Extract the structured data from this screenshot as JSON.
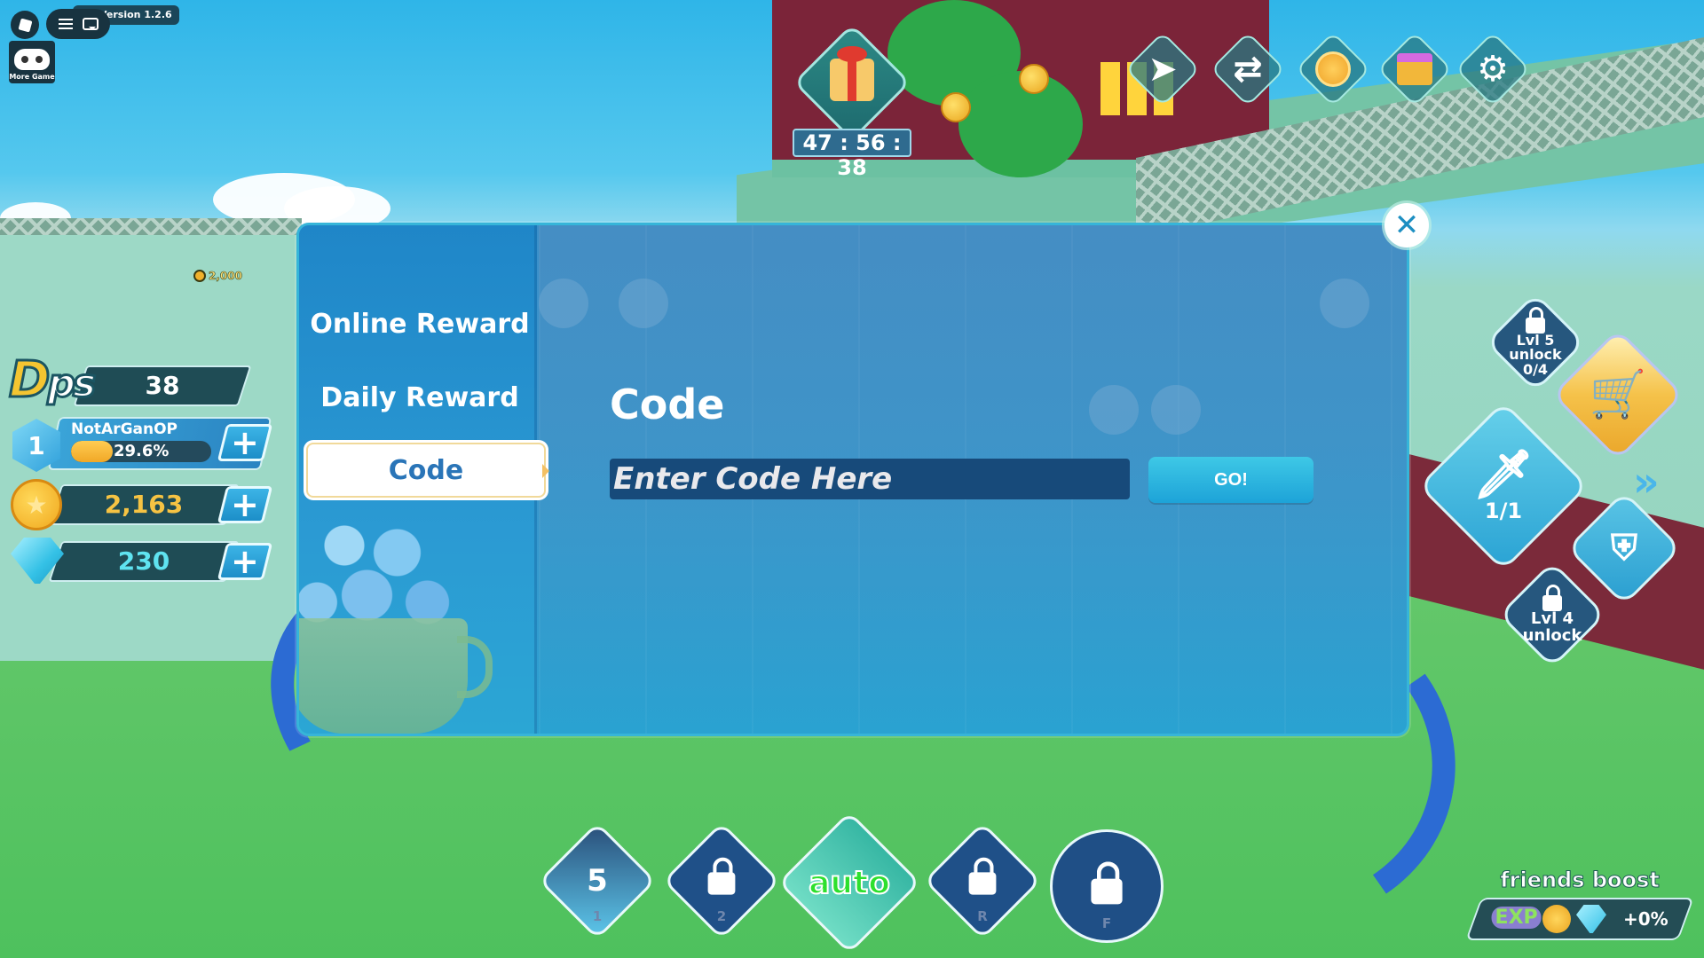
{
  "top_left": {
    "version_label": "Version 1.2.6",
    "more_game_label": "More Game"
  },
  "hud": {
    "dps_label": "Dps",
    "dps_value": "38",
    "player_level": "1",
    "player_name": "NotArGanOP",
    "xp_percent_text": "29.6%",
    "xp_fraction": 0.296,
    "coins": "2,163",
    "gems": "230",
    "plus_symbol": "+"
  },
  "world": {
    "floating_coin_amount": "2,000"
  },
  "gift": {
    "timer": "47 : 56 : 38"
  },
  "top_right_icons": [
    {
      "name": "send-icon",
      "glyph": "➤"
    },
    {
      "name": "trade-icon",
      "glyph": "⇄"
    },
    {
      "name": "medal-icon",
      "glyph": ""
    },
    {
      "name": "present-icon",
      "glyph": ""
    },
    {
      "name": "gear-icon",
      "glyph": "⚙"
    }
  ],
  "modal": {
    "tabs": [
      {
        "label": "Online Reward",
        "active": false
      },
      {
        "label": "Daily Reward",
        "active": false
      },
      {
        "label": "Code",
        "active": true
      }
    ],
    "section_title": "Code",
    "code_input": {
      "value": "",
      "placeholder": "Enter Code Here"
    },
    "go_label": "GO!",
    "close_glyph": "✕"
  },
  "right_panel": {
    "lvl5_line1": "Lvl 5",
    "lvl5_line2": "unlock",
    "lvl5_progress": "0/4",
    "sword_count": "1/1",
    "lvl4_line1": "Lvl 4",
    "lvl4_line2": "unlock",
    "arrows_glyph": "»"
  },
  "hotbar": {
    "slot1_value": "5",
    "slot1_key": "1",
    "slot2_key": "2",
    "auto_label": "auto",
    "slotR_key": "R",
    "slotF_key": "F"
  },
  "friends_boost": {
    "title": "friends boost",
    "exp_label": "EXP",
    "value": "+0%"
  }
}
